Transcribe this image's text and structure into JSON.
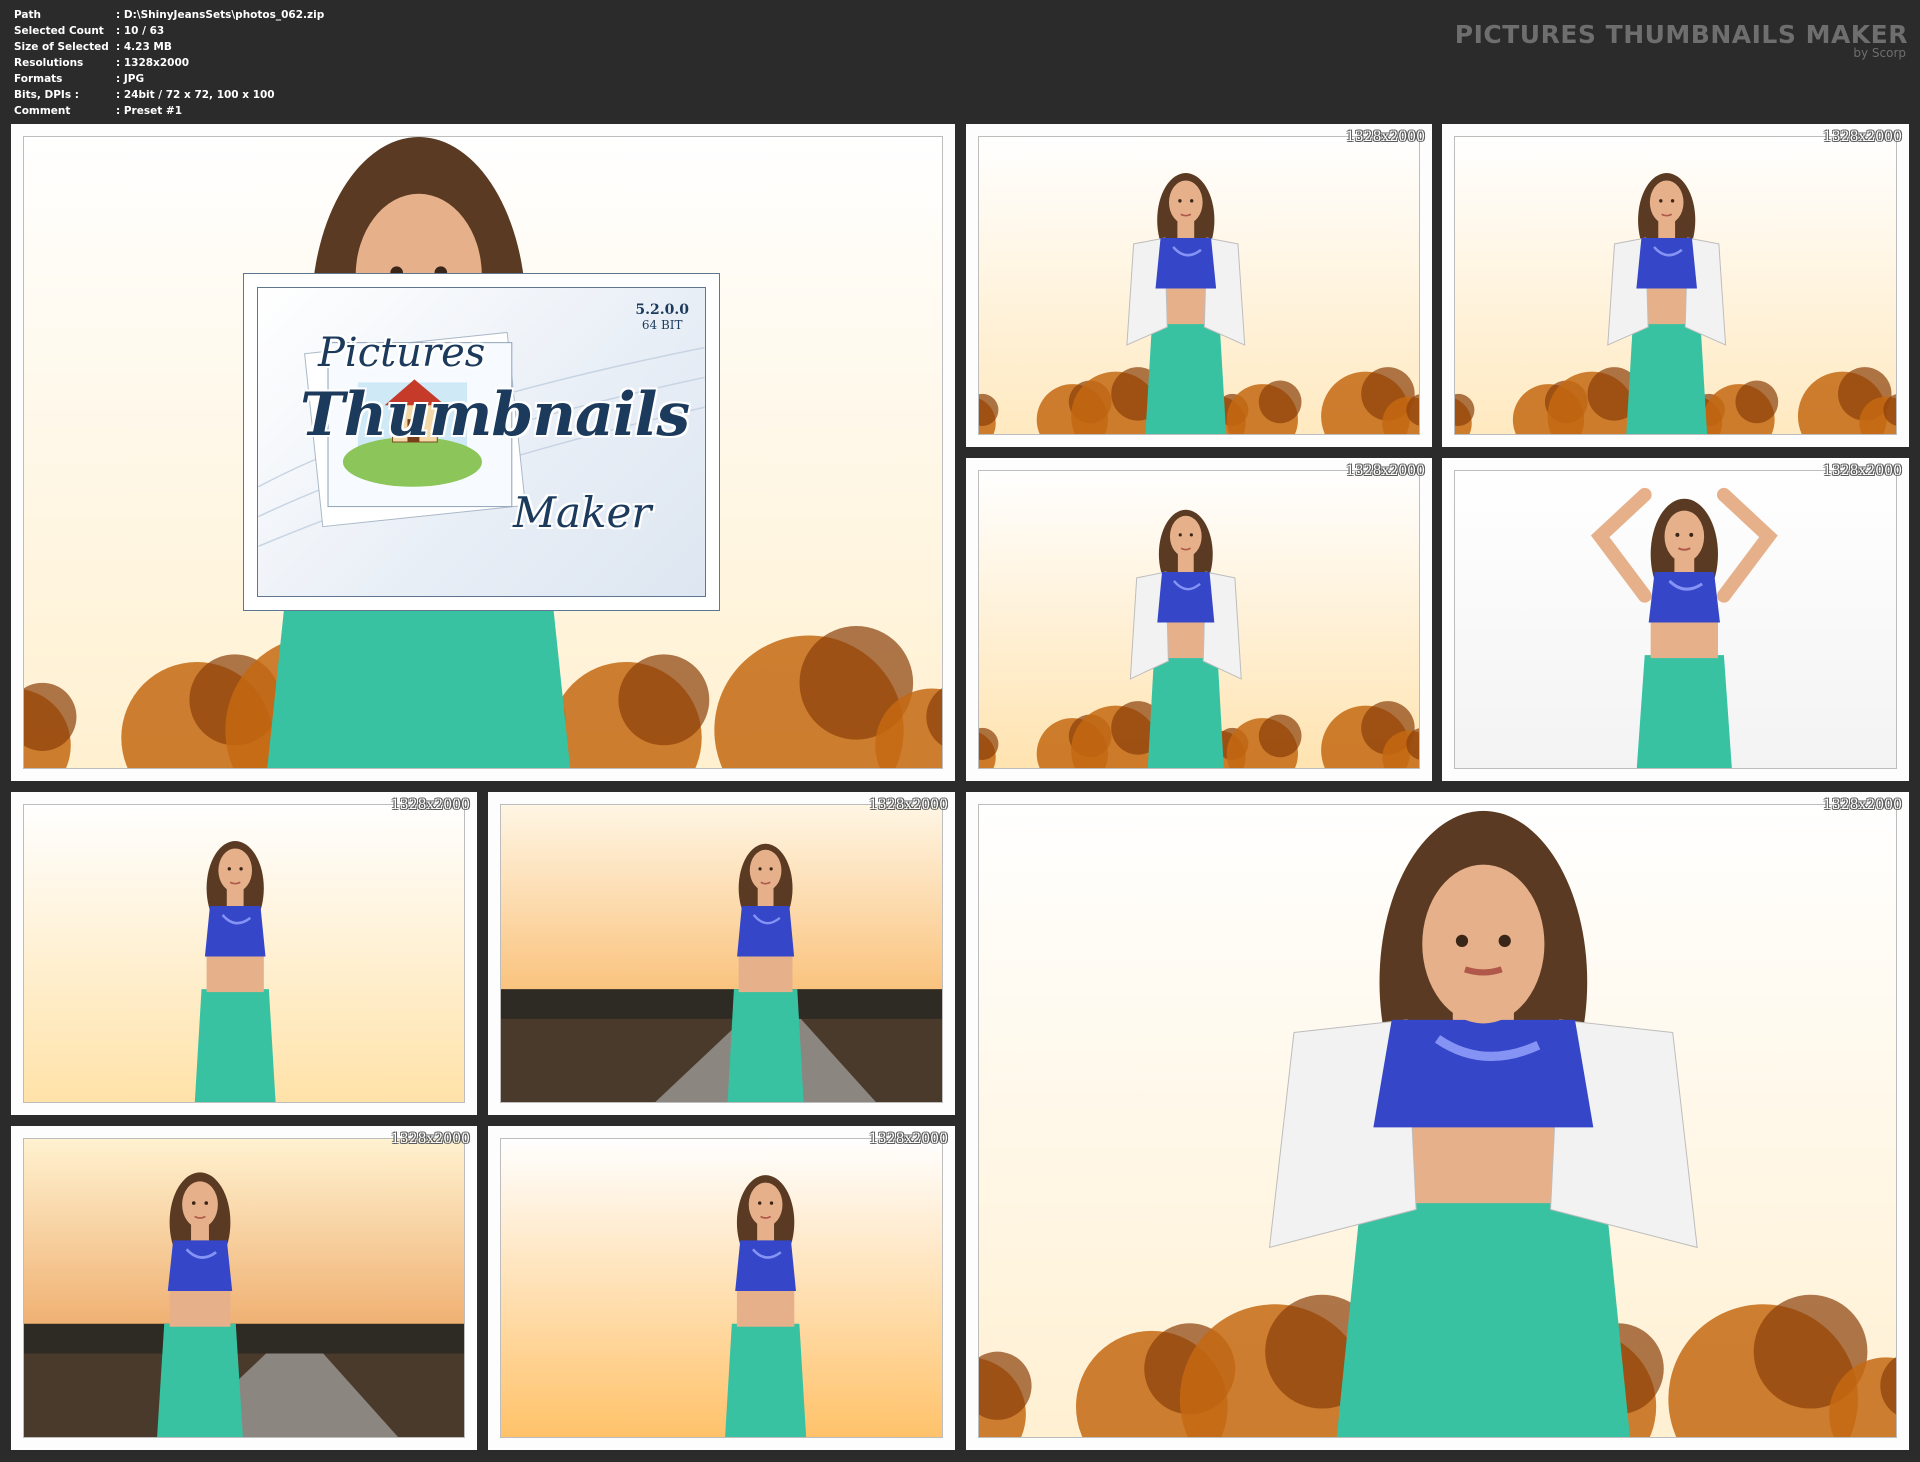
{
  "header": {
    "meta": [
      {
        "key": "Path",
        "value": ": D:\\ShinyJeansSets\\photos_062.zip"
      },
      {
        "key": "Selected Count",
        "value": ": 10 / 63"
      },
      {
        "key": "Size of Selected",
        "value": ": 4.23 MB"
      },
      {
        "key": "Resolutions",
        "value": ": 1328x2000"
      },
      {
        "key": "Formats",
        "value": ": JPG"
      },
      {
        "key": "Bits, DPIs :",
        "value": ": 24bit / 72 x 72, 100 x 100"
      },
      {
        "key": "Comment",
        "value": ": Preset #1"
      }
    ],
    "brand_title": "PICTURES THUMBNAILS MAKER",
    "brand_sub": "by Scorp"
  },
  "splash": {
    "word1": "Pictures",
    "word2": "Thumbnails",
    "word3": "Maker",
    "version": "5.2.0.0",
    "bitness": "64 BIT"
  },
  "thumbnails": [
    {
      "label": "1328x2000"
    },
    {
      "label": "1328x2000"
    },
    {
      "label": "1328x2000"
    },
    {
      "label": "1328x2000"
    },
    {
      "label": "1328x2000"
    },
    {
      "label": "1328x2000"
    },
    {
      "label": "1328x2000"
    },
    {
      "label": "1328x2000"
    },
    {
      "label": "1328x2000"
    }
  ],
  "colors": {
    "background": "#2b2b2b",
    "tile": "#fdfdfd",
    "top_color": "#3547c8",
    "jeans_color": "#38c2a2",
    "jacket_color": "#f2f2f2",
    "hair_color": "#5a3a22",
    "skin_color": "#e6b08a",
    "trees_color": "#c46812"
  }
}
